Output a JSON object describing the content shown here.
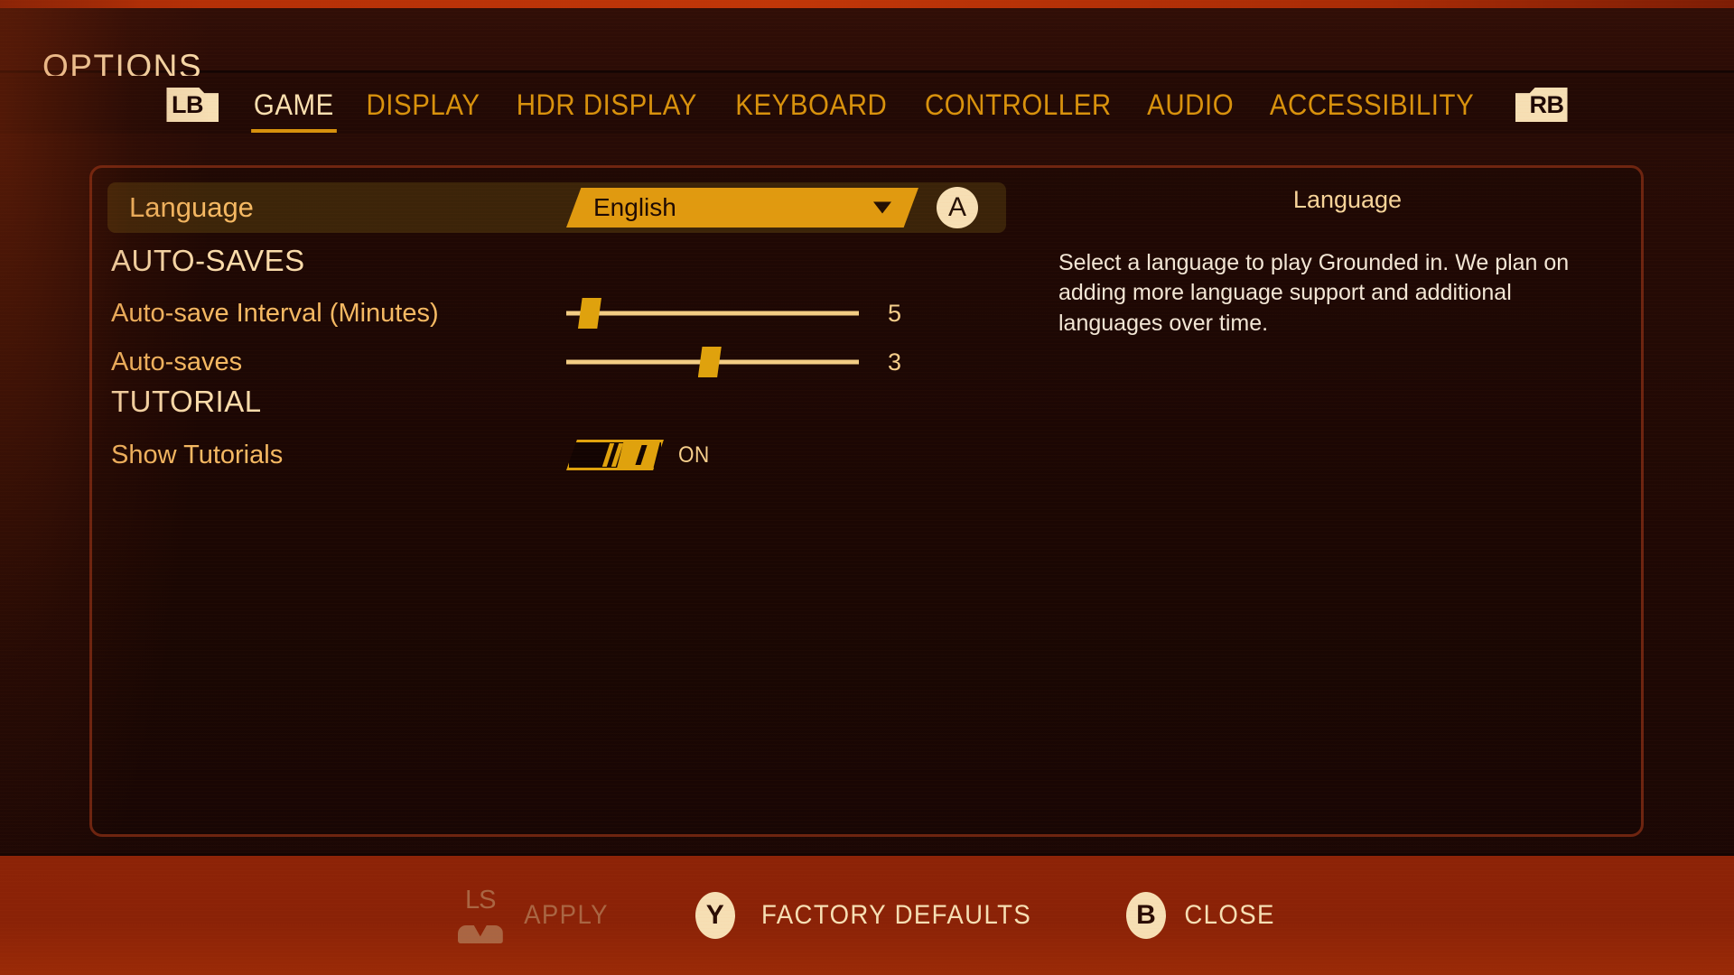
{
  "header": {
    "title": "OPTIONS"
  },
  "tabs": {
    "left_bumper": "LB",
    "right_bumper": "RB",
    "items": [
      {
        "label": "GAME",
        "active": true
      },
      {
        "label": "DISPLAY",
        "active": false
      },
      {
        "label": "HDR DISPLAY",
        "active": false
      },
      {
        "label": "KEYBOARD",
        "active": false
      },
      {
        "label": "CONTROLLER",
        "active": false
      },
      {
        "label": "AUDIO",
        "active": false
      },
      {
        "label": "ACCESSIBILITY",
        "active": false
      }
    ]
  },
  "settings": {
    "language_row": {
      "label": "Language",
      "value": "English",
      "confirm_button": "A"
    },
    "autosaves_heading": "AUTO-SAVES",
    "autosave_interval": {
      "label": "Auto-save Interval (Minutes)",
      "value": "5",
      "percent": 4
    },
    "autosaves_count": {
      "label": "Auto-saves",
      "value": "3",
      "percent": 45
    },
    "tutorial_heading": "TUTORIAL",
    "show_tutorials": {
      "label": "Show Tutorials",
      "state": "ON"
    }
  },
  "description": {
    "title": "Language",
    "body": "Select a language to play Grounded in. We plan on adding more language support and additional languages over time."
  },
  "footer": {
    "actions": [
      {
        "glyph": "LS",
        "label": "APPLY",
        "disabled": true
      },
      {
        "glyph": "Y",
        "label": "FACTORY DEFAULTS",
        "disabled": false
      },
      {
        "glyph": "B",
        "label": "CLOSE",
        "disabled": false
      }
    ]
  },
  "colors": {
    "accent_gold": "#dfa20d",
    "cream": "#f6dfb4",
    "tab_inactive": "#d8920d",
    "label_orange": "#f5b963",
    "bar_red": "#8a2207"
  }
}
